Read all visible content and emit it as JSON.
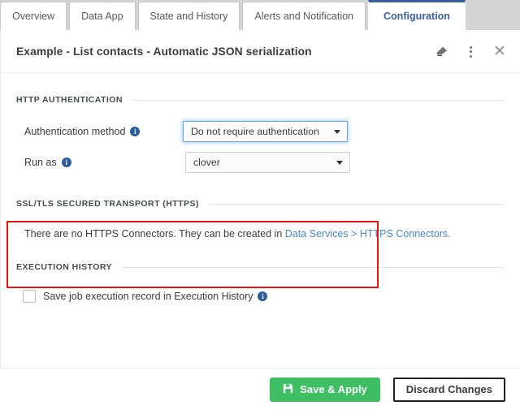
{
  "tabs": [
    {
      "label": "Overview",
      "active": false
    },
    {
      "label": "Data App",
      "active": false
    },
    {
      "label": "State and History",
      "active": false
    },
    {
      "label": "Alerts and Notification",
      "active": false
    },
    {
      "label": "Configuration",
      "active": true
    }
  ],
  "header": {
    "title": "Example - List contacts - Automatic JSON serialization",
    "icons": {
      "eraser": "eraser-icon",
      "kebab": "more-options-icon",
      "close": "close-icon",
      "close_glyph": "✕"
    }
  },
  "sections": {
    "http_auth": {
      "title": "HTTP AUTHENTICATION",
      "auth_method": {
        "label": "Authentication method",
        "value": "Do not require authentication",
        "info": "i"
      },
      "run_as": {
        "label": "Run as",
        "value": "clover",
        "info": "i"
      }
    },
    "ssl_tls": {
      "title": "SSL/TLS SECURED TRANSPORT (HTTPS)",
      "message_prefix": "There are no HTTPS Connectors. They can be created in ",
      "link_text": "Data Services > HTTPS Connectors."
    },
    "execution_history": {
      "title": "EXECUTION HISTORY",
      "checkbox_label": "Save job execution record in Execution History",
      "checkbox_checked": false,
      "info": "i"
    }
  },
  "footer": {
    "save_label": "Save & Apply",
    "discard_label": "Discard Changes"
  },
  "colors": {
    "accent_blue": "#3a5fa0",
    "link_blue": "#4a86c8",
    "save_green": "#3fbf63",
    "highlight_red": "#ee1111",
    "info_blue": "#2c5c9a",
    "tabstrip_bg": "#d4d4d4"
  }
}
